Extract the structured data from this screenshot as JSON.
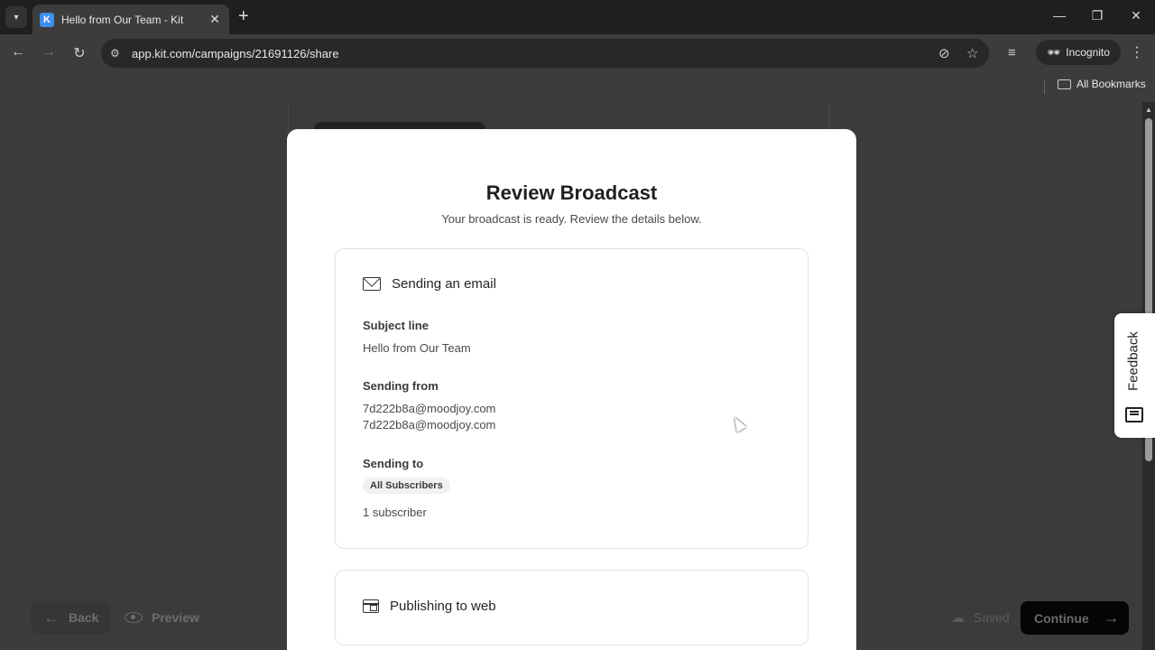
{
  "browser": {
    "tab_title": "Hello from Our Team - Kit",
    "tab_favicon": "K",
    "url": "app.kit.com/campaigns/21691126/share",
    "incognito_label": "Incognito",
    "all_bookmarks_label": "All Bookmarks"
  },
  "modal": {
    "title": "Review Broadcast",
    "subtitle": "Your broadcast is ready. Review the details below.",
    "email_card": {
      "heading": "Sending an email",
      "subject_label": "Subject line",
      "subject_value": "Hello from Our Team",
      "from_label": "Sending from",
      "from_value_1": "7d222b8a@moodjoy.com",
      "from_value_2": "7d222b8a@moodjoy.com",
      "to_label": "Sending to",
      "to_tag": "All Subscribers",
      "subscriber_count": "1 subscriber"
    },
    "web_card": {
      "heading": "Publishing to web"
    }
  },
  "footer": {
    "back_label": "Back",
    "preview_label": "Preview",
    "saved_label": "Saved",
    "continue_label": "Continue"
  },
  "feedback_label": "Feedback",
  "colors": {
    "accent_favicon": "#3d8ef0",
    "continue_bg": "#050505",
    "overlay_bg": "#3b3b3b"
  }
}
